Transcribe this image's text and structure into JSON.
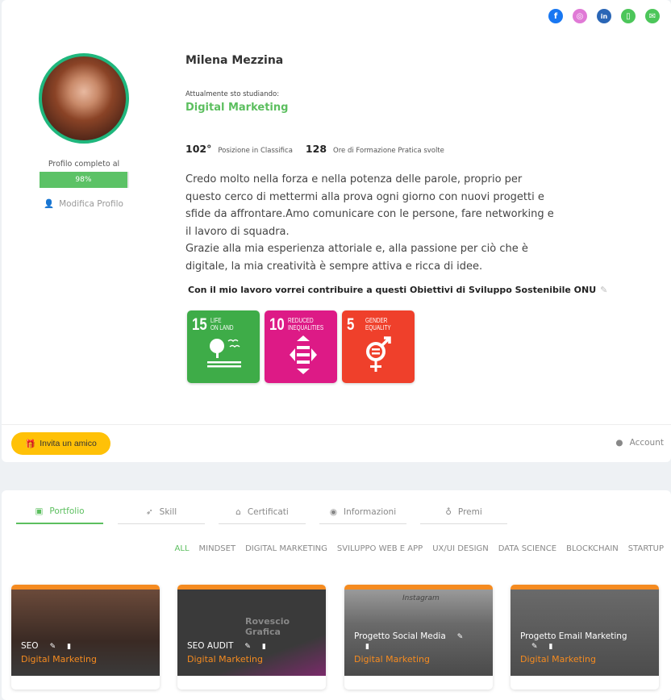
{
  "social": [
    {
      "icon": "facebook-icon",
      "color": "#1877f2",
      "glyph": "f"
    },
    {
      "icon": "instagram-icon",
      "color": "#e07ad6",
      "glyph": "◎"
    },
    {
      "icon": "linkedin-icon",
      "color": "#2a66b6",
      "glyph": "in"
    },
    {
      "icon": "phone-icon",
      "color": "#4cc65a",
      "glyph": "▯"
    },
    {
      "icon": "email-icon",
      "color": "#4cc65a",
      "glyph": "✉"
    }
  ],
  "profile": {
    "name": "Milena Mezzina",
    "complete_label": "Profilo completo al",
    "complete_value": "98%",
    "complete_percent": 98,
    "edit_label": "Modifica Profilo",
    "studying_label": "Attualmente sto studiando:",
    "studying": "Digital Marketing",
    "rank": "102°",
    "rank_label": "Posizione in Classifica",
    "hours": "128",
    "hours_label": "Ore di Formazione Pratica svolte",
    "bio": [
      "Credo molto nella forza e nella potenza delle parole, proprio per",
      "questo cerco di mettermi alla prova ogni giorno con nuovi progetti e",
      "sfide da affrontare.Amo comunicare con le persone, fare networking e",
      "il lavoro di squadra.",
      "Grazie alla mia esperienza attoriale e, alla passione per ciò che è",
      "digitale, la mia creatività è sempre attiva e ricca di idee."
    ]
  },
  "sdg": {
    "title": "Con il mio lavoro vorrei contribuire a questi Obiettivi di Sviluppo Sostenibile ONU",
    "goals": [
      {
        "number": "15",
        "title1": "LIFE",
        "title2": "ON LAND",
        "color": "#3eac48"
      },
      {
        "number": "10",
        "title1": "REDUCED",
        "title2": "INEQUALITIES",
        "color": "#dd1a86"
      },
      {
        "number": "5",
        "title1": "GENDER",
        "title2": "EQUALITY",
        "color": "#ef402b"
      }
    ]
  },
  "footer": {
    "invite": "Invita un amico",
    "account": "Account"
  },
  "tabs": [
    {
      "label": "Portfolio",
      "icon": "briefcase-icon",
      "glyph": "▣"
    },
    {
      "label": "Skill",
      "icon": "rocket-icon",
      "glyph": "➶"
    },
    {
      "label": "Certificati",
      "icon": "graduation-cap-icon",
      "glyph": "🎓"
    },
    {
      "label": "Informazioni",
      "icon": "user-circle-icon",
      "glyph": "◉"
    },
    {
      "label": "Premi",
      "icon": "award-icon",
      "glyph": "♁"
    }
  ],
  "filters": [
    "ALL",
    "MINDSET",
    "DIGITAL MARKETING",
    "SVILUPPO WEB E APP",
    "UX/UI DESIGN",
    "DATA SCIENCE",
    "BLOCKCHAIN",
    "STARTUP"
  ],
  "projects": [
    {
      "title": "SEO",
      "category": "Digital Marketing"
    },
    {
      "title": "SEO AUDIT",
      "category": "Digital Marketing",
      "image_text": "Rovescio Grafica"
    },
    {
      "title": "Progetto Social Media",
      "category": "Digital Marketing",
      "image_text": "Instagram"
    },
    {
      "title": "Progetto Email Marketing",
      "category": "Digital Marketing"
    }
  ]
}
